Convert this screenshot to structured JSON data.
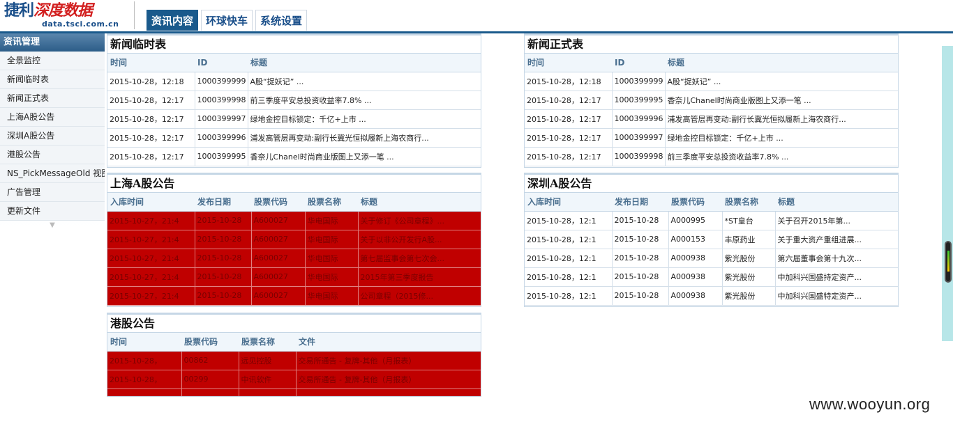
{
  "logo": {
    "brand_part1": "捷利",
    "brand_part2": "深度数据",
    "domain": "data.tsci.com.cn"
  },
  "nav": {
    "tabs": [
      {
        "label": "资讯内容",
        "active": true
      },
      {
        "label": "环球快车",
        "active": false
      },
      {
        "label": "系统设置",
        "active": false
      }
    ]
  },
  "sidebar": {
    "title": "资讯管理",
    "items": [
      "全景监控",
      "新闻临时表",
      "新闻正式表",
      "上海A股公告",
      "深圳A股公告",
      "港股公告",
      "NS_PickMessageOld 视图",
      "广告管理",
      "更新文件"
    ],
    "more_icon": "▼"
  },
  "panels": {
    "news_temp": {
      "title": "新闻临时表",
      "headers": [
        "时间",
        "ID",
        "标题"
      ],
      "rows": [
        [
          "2015-10-28，12:18",
          "1000399999",
          "A股“捉妖记” ..."
        ],
        [
          "2015-10-28，12:17",
          "1000399998",
          "前三季度平安总投资收益率7.8% ..."
        ],
        [
          "2015-10-28，12:17",
          "1000399997",
          "绿地金控目标锁定：千亿+上市 ..."
        ],
        [
          "2015-10-28，12:17",
          "1000399996",
          "浦发高管层再变动:副行长冀光恒拟履新上海农商行..."
        ],
        [
          "2015-10-28，12:17",
          "1000399995",
          "香奈儿Chanel时尚商业版图上又添一笔 ..."
        ]
      ]
    },
    "news_formal": {
      "title": "新闻正式表",
      "headers": [
        "时间",
        "ID",
        "标题"
      ],
      "rows": [
        [
          "2015-10-28，12:18",
          "1000399999",
          "A股“捉妖记” ..."
        ],
        [
          "2015-10-28，12:17",
          "1000399995",
          "香奈儿Chanel时尚商业版图上又添一笔 ..."
        ],
        [
          "2015-10-28，12:17",
          "1000399996",
          "浦发高管层再变动:副行长冀光恒拟履新上海农商行..."
        ],
        [
          "2015-10-28，12:17",
          "1000399997",
          "绿地金控目标锁定：千亿+上市 ..."
        ],
        [
          "2015-10-28，12:17",
          "1000399998",
          "前三季度平安总投资收益率7.8% ..."
        ]
      ]
    },
    "sh_a": {
      "title": "上海A股公告",
      "headers": [
        "入库时间",
        "发布日期",
        "股票代码",
        "股票名称",
        "标题"
      ],
      "rows": [
        [
          "2015-10-27，21:4",
          "2015-10-28",
          "A600027",
          "华电国际",
          "关于修订《公司章程》..."
        ],
        [
          "2015-10-27，21:4",
          "2015-10-28",
          "A600027",
          "华电国际",
          "关于以非公开发行A股..."
        ],
        [
          "2015-10-27，21:4",
          "2015-10-28",
          "A600027",
          "华电国际",
          "第七届监事会第七次会..."
        ],
        [
          "2015-10-27，21:4",
          "2015-10-28",
          "A600027",
          "华电国际",
          "2015年第三季度报告"
        ],
        [
          "2015-10-27，21:4",
          "2015-10-28",
          "A600027",
          "华电国际",
          "公司章程（2015修..."
        ]
      ]
    },
    "sz_a": {
      "title": "深圳A股公告",
      "headers": [
        "入库时间",
        "发布日期",
        "股票代码",
        "股票名称",
        "标题"
      ],
      "rows": [
        [
          "2015-10-28，12:1",
          "2015-10-28",
          "A000995",
          "*ST皇台",
          "关于召开2015年第..."
        ],
        [
          "2015-10-28，12:1",
          "2015-10-28",
          "A000153",
          "丰原药业",
          "关于重大资产重组进展..."
        ],
        [
          "2015-10-28，12:1",
          "2015-10-28",
          "A000938",
          "紫光股份",
          "第六届董事会第十九次..."
        ],
        [
          "2015-10-28，12:1",
          "2015-10-28",
          "A000938",
          "紫光股份",
          "中加科兴国盛持定资产..."
        ],
        [
          "2015-10-28，12:1",
          "2015-10-28",
          "A000938",
          "紫光股份",
          "中加科兴国盛特定资产..."
        ]
      ]
    },
    "hk": {
      "title": "港股公告",
      "headers": [
        "时间",
        "股票代码",
        "股票名称",
        "文件"
      ],
      "rows": [
        [
          "2015-10-28，",
          "00862",
          "远见控股",
          "交易所通告 - 复牌-其他（月报表）"
        ],
        [
          "2015-10-28，",
          "00299",
          "中讯软件",
          "交易所通告 - 复牌-其他（月报表）"
        ]
      ]
    }
  },
  "watermark": "www.wooyun.org",
  "colors": {
    "accent": "#1a5a8c",
    "alert_row": "#c00000",
    "header_text": "#4a6f8f"
  }
}
